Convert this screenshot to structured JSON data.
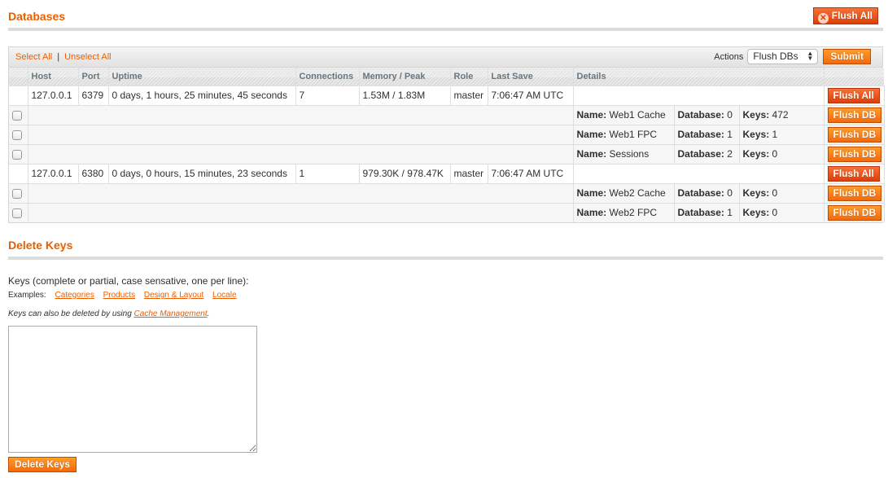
{
  "databases": {
    "title": "Databases",
    "flush_all_label": "Flush All",
    "select_all": "Select All",
    "separator": "|",
    "unselect_all": "Unselect All",
    "actions_label": "Actions",
    "actions_selected": "Flush DBs",
    "submit_label": "Submit",
    "columns": [
      "",
      "Host",
      "Port",
      "Uptime",
      "Connections",
      "Memory / Peak",
      "Role",
      "Last Save",
      "Details",
      ""
    ],
    "servers": [
      {
        "host": "127.0.0.1",
        "port": "6379",
        "uptime": "0 days, 1 hours, 25 minutes, 45 seconds",
        "connections": "7",
        "memory": "1.53M / 1.83M",
        "role": "master",
        "last_save": "7:06:47 AM UTC",
        "action_label": "Flush All",
        "dbs": [
          {
            "name": "Web1 Cache",
            "database": "0",
            "keys": "472",
            "action_label": "Flush DB"
          },
          {
            "name": "Web1 FPC",
            "database": "1",
            "keys": "1",
            "action_label": "Flush DB"
          },
          {
            "name": "Sessions",
            "database": "2",
            "keys": "0",
            "action_label": "Flush DB"
          }
        ]
      },
      {
        "host": "127.0.0.1",
        "port": "6380",
        "uptime": "0 days, 0 hours, 15 minutes, 23 seconds",
        "connections": "1",
        "memory": "979.30K / 978.47K",
        "role": "master",
        "last_save": "7:06:47 AM UTC",
        "action_label": "Flush All",
        "dbs": [
          {
            "name": "Web2 Cache",
            "database": "0",
            "keys": "0",
            "action_label": "Flush DB"
          },
          {
            "name": "Web2 FPC",
            "database": "1",
            "keys": "0",
            "action_label": "Flush DB"
          }
        ]
      }
    ],
    "labels": {
      "name": "Name:",
      "database": "Database:",
      "keys": "Keys:"
    }
  },
  "delete_keys": {
    "title": "Delete Keys",
    "field_label": "Keys (complete or partial, case sensative, one per line):",
    "examples_label": "Examples:",
    "examples": [
      "Categories",
      "Products",
      "Design & Layout",
      "Locale"
    ],
    "note_prefix": "Keys can also be deleted by using ",
    "note_link": "Cache Management",
    "note_suffix": ".",
    "textarea_value": "",
    "button_label": "Delete Keys"
  },
  "colors": {
    "accent": "#eb5e00",
    "button": "#f26a0b",
    "button_red": "#dd3f0a"
  }
}
